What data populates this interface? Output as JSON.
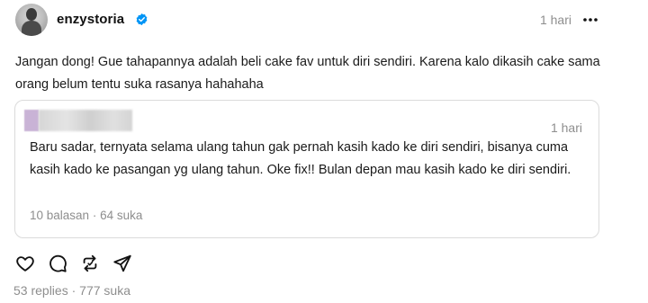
{
  "post": {
    "username": "enzystoria",
    "time": "1 hari",
    "text": "Jangan dong! Gue tahapannya adalah beli cake fav untuk diri sendiri. Karena kalo dikasih cake sama orang belum tentu suka rasanya hahahaha"
  },
  "quoted": {
    "time": "1 hari",
    "text": "Baru sadar, ternyata selama ulang tahun gak pernah kasih kado ke diri sendiri, bisanya cuma kasih kado ke pasangan yg ulang tahun. Oke fix!! Bulan depan mau kasih kado ke diri sendiri.",
    "replies": "10 balasan",
    "separator": "·",
    "likes": "64 suka"
  },
  "footer": {
    "replies": "53 replies",
    "separator": "·",
    "likes": "777 suka"
  },
  "icons": {
    "verified": "verified-badge-icon",
    "more": "more-horizontal-icon",
    "like": "heart-icon",
    "reply": "comment-icon",
    "repost": "repost-icon",
    "share": "send-icon"
  },
  "colors": {
    "verified": "#0095f6",
    "muted": "#8e8e8e",
    "border": "#dbdbdb"
  }
}
